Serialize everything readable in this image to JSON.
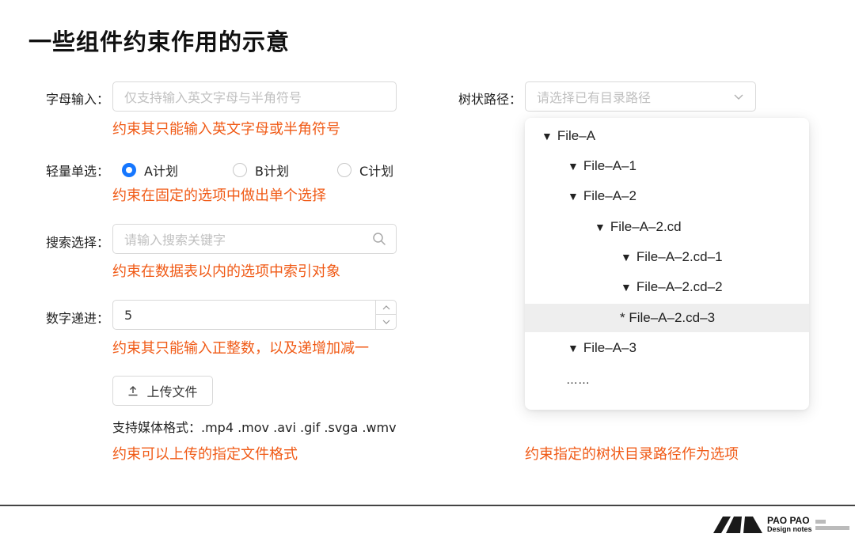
{
  "page_title": "一些组件约束作用的示意",
  "text_input": {
    "label": "字母输入：",
    "placeholder": "仅支持输入英文字母与半角符号",
    "note": "约束其只能输入英文字母或半角符号"
  },
  "radio_group": {
    "label": "轻量单选：",
    "options": [
      {
        "label": "A计划",
        "checked": true
      },
      {
        "label": "B计划",
        "checked": false
      },
      {
        "label": "C计划",
        "checked": false
      }
    ],
    "note": "约束在固定的选项中做出单个选择"
  },
  "search_select": {
    "label": "搜索选择：",
    "placeholder": "请输入搜索关键字",
    "icon": "search-icon",
    "note": "约束在数据表以内的选项中索引对象"
  },
  "number_stepper": {
    "label": "数字递进：",
    "value": "5",
    "note": "约束其只能输入正整数，以及递增加减一"
  },
  "upload": {
    "button_label": "上传文件",
    "icon": "upload-icon",
    "formats_label": "支持媒体格式：.mp4  .mov  .avi  .gif  .svga  .wmv",
    "note": "约束可以上传的指定文件格式"
  },
  "tree_select": {
    "label": "树状路径：",
    "placeholder": "请选择已有目录路径",
    "icon": "chevron-down-icon",
    "items": [
      {
        "text": "File–A",
        "marker": "▼",
        "level": 0
      },
      {
        "text": "File–A–1",
        "marker": "▼",
        "level": 1
      },
      {
        "text": "File–A–2",
        "marker": "▼",
        "level": 1
      },
      {
        "text": "File–A–2.cd",
        "marker": "▼",
        "level": 2
      },
      {
        "text": "File–A–2.cd–1",
        "marker": "▼",
        "level": 3
      },
      {
        "text": "File–A–2.cd–2",
        "marker": "▼",
        "level": 3
      },
      {
        "text": "* File–A–2.cd–3",
        "marker": "",
        "level": 3,
        "active": true
      },
      {
        "text": "File–A–3",
        "marker": "▼",
        "level": 1
      },
      {
        "text": "……",
        "marker": "",
        "level": 1
      }
    ],
    "note": "约束指定的树状目录路径作为选项"
  },
  "brand": {
    "line1": "PAO PAO",
    "line2": "Design notes"
  },
  "colors": {
    "accent_orange": "#f05a16",
    "primary_blue": "#1677ff",
    "border": "#d9d9d9"
  }
}
